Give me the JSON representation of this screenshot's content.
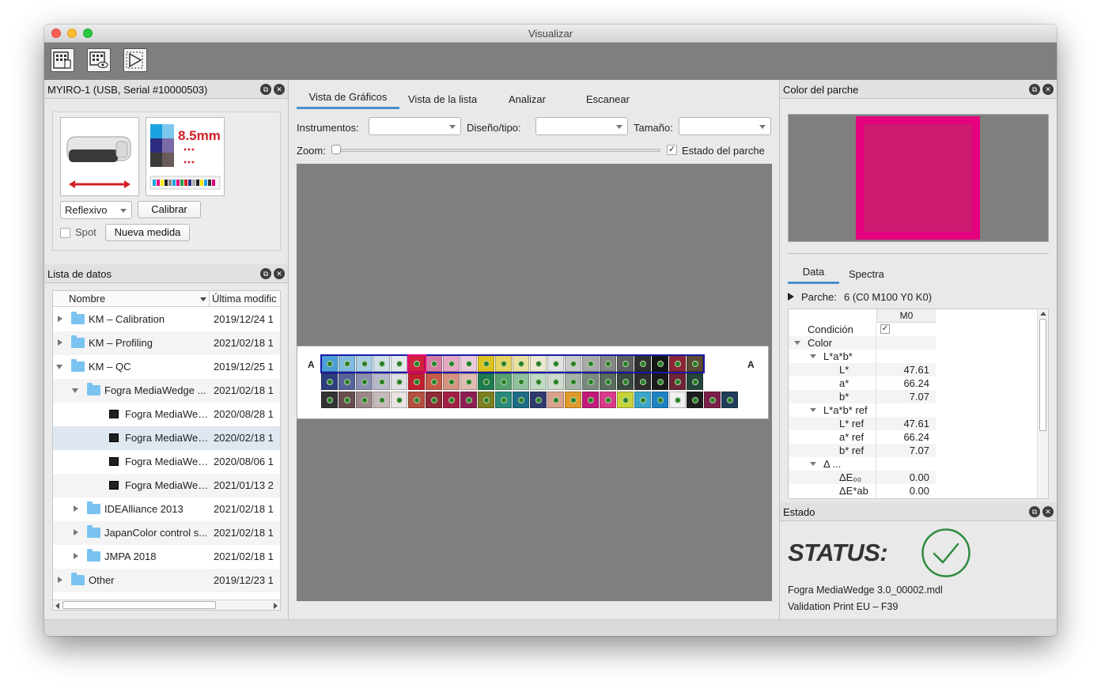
{
  "window": {
    "title": "Visualizar"
  },
  "toolbar": {
    "buttons": [
      {
        "icon": "measure-chart-icon"
      },
      {
        "icon": "view-chart-icon"
      },
      {
        "icon": "play-measure-icon"
      }
    ]
  },
  "instrument_panel": {
    "header": "MYIRO-1 (USB, Serial #10000503)",
    "chart_image_text": "8.5mm",
    "mode_select": "Reflexivo",
    "calibrate_label": "Calibrar",
    "spot_label": "Spot",
    "new_measure_label": "Nueva medida"
  },
  "data_list": {
    "header": "Lista de datos",
    "columns": {
      "name": "Nombre",
      "date": "Última modific"
    },
    "rows": [
      {
        "name": "KM – Calibration",
        "date": "2019/12/24 1",
        "type": "folder",
        "level": 0,
        "state": "closed"
      },
      {
        "name": "KM – Profiling",
        "date": "2021/02/18 1",
        "type": "folder",
        "level": 0,
        "state": "closed"
      },
      {
        "name": "KM – QC",
        "date": "2019/12/25 1",
        "type": "folder",
        "level": 0,
        "state": "open"
      },
      {
        "name": "Fogra MediaWedge ...",
        "date": "2021/02/18 1",
        "type": "folder",
        "level": 1,
        "state": "open"
      },
      {
        "name": "Fogra MediaWed...",
        "date": "2020/08/28 1",
        "type": "file",
        "level": 2
      },
      {
        "name": "Fogra MediaWed...",
        "date": "2020/02/18 1",
        "type": "file",
        "level": 2,
        "selected": true
      },
      {
        "name": "Fogra MediaWed...",
        "date": "2020/08/06 1",
        "type": "file",
        "level": 2
      },
      {
        "name": "Fogra MediaWed...",
        "date": "2021/01/13 2",
        "type": "file",
        "level": 2
      },
      {
        "name": "IDEAlliance 2013",
        "date": "2021/02/18 1",
        "type": "folder",
        "level": 1,
        "state": "closed"
      },
      {
        "name": "JapanColor control s...",
        "date": "2021/02/18 1",
        "type": "folder",
        "level": 1,
        "state": "closed"
      },
      {
        "name": "JMPA 2018",
        "date": "2021/02/18 1",
        "type": "folder",
        "level": 1,
        "state": "closed"
      },
      {
        "name": "Other",
        "date": "2019/12/23 1",
        "type": "folder",
        "level": 0,
        "state": "closed"
      }
    ]
  },
  "center": {
    "tabs": [
      "Vista de Gráficos",
      "Vista de la lista",
      "Analizar",
      "Escanear"
    ],
    "instruments_label": "Instrumentos:",
    "layout_label": "Diseño/tipo:",
    "size_label": "Tamaño:",
    "zoom_label": "Zoom:",
    "patch_state_label": "Estado del parche",
    "patch_state_checked": true,
    "chart_row_label": "A",
    "patch_colors": [
      [
        "#4a9fd6",
        "#7fb9dd",
        "#a9cde2",
        "#cfdfe7",
        "#e2e8ec",
        "#d0213f",
        "#d57ba4",
        "#e5a8c3",
        "#ecc9d8",
        "#ddc21d",
        "#e5d45f",
        "#ebe0a0",
        "#ece8d1",
        "#e2e2e2",
        "#c8c8c8",
        "#a9a9a9",
        "#868686",
        "#5e5e5e",
        "#2f2f2f",
        "#151515",
        "#8a2635",
        "#5a4a33"
      ],
      [
        "#2d3d7e",
        "#57649a",
        "#8a8eb0",
        "#b9b9c9",
        "#dedee4",
        "#c21f2e",
        "#c55a48",
        "#d59283",
        "#dfbcb2",
        "#1d7b50",
        "#56a070",
        "#90c0a0",
        "#c1dac6",
        "#cfdacf",
        "#a4b2a7",
        "#7b8a7f",
        "#5b6b60",
        "#3b4a40",
        "#2e2e2e",
        "#1a1a1a",
        "#6d2437",
        "#24453a"
      ],
      [
        "#333333",
        "#6a4e4e",
        "#9d8789",
        "#c7b9bb",
        "#e9e2e3",
        "#b45040",
        "#8f2a36",
        "#a42046",
        "#8d1f55",
        "#7d7f23",
        "#2a8a7a",
        "#1f6b85",
        "#303a6e",
        "#d9a28c",
        "#e09a2b",
        "#c2197a",
        "#d93b8a",
        "#c8d23c",
        "#3aa5c9",
        "#1d82c4",
        "#f0f0f0",
        "#1e1e1e",
        "#7a1f4a",
        "#1f3c5a"
      ]
    ]
  },
  "patch_color_panel": {
    "header": "Color del parche",
    "outer_color": "#e4007f",
    "inner_color": "#cb1a6f"
  },
  "data_panel": {
    "tabs": [
      "Data",
      "Spectra"
    ],
    "patch_label": "Parche:",
    "patch_value": "6 (C0 M100 Y0 K0)",
    "column_header": "M0",
    "rows": [
      {
        "label": "Condición",
        "value": "✓",
        "indent": 0
      },
      {
        "label": "Color",
        "value": "",
        "indent": 0,
        "twisty": "open"
      },
      {
        "label": "L*a*b*",
        "value": "",
        "indent": 1,
        "twisty": "open"
      },
      {
        "label": "L*",
        "value": "47.61",
        "indent": 2
      },
      {
        "label": "a*",
        "value": "66.24",
        "indent": 2
      },
      {
        "label": "b*",
        "value": "7.07",
        "indent": 2
      },
      {
        "label": "L*a*b* ref",
        "value": "",
        "indent": 1,
        "twisty": "open"
      },
      {
        "label": "L* ref",
        "value": "47.61",
        "indent": 2
      },
      {
        "label": "a* ref",
        "value": "66.24",
        "indent": 2
      },
      {
        "label": "b* ref",
        "value": "7.07",
        "indent": 2
      },
      {
        "label": "Δ ...",
        "value": "",
        "indent": 1,
        "twisty": "open"
      },
      {
        "label": "ΔE₀₀",
        "value": "0.00",
        "indent": 2
      },
      {
        "label": "ΔE*ab",
        "value": "0.00",
        "indent": 2
      }
    ]
  },
  "status_panel": {
    "header": "Estado",
    "status_text": "STATUS:",
    "line1": "Fogra MediaWedge 3.0_00002.mdl",
    "line2": "Validation Print EU – F39",
    "ok_color": "#2e8b3e"
  }
}
